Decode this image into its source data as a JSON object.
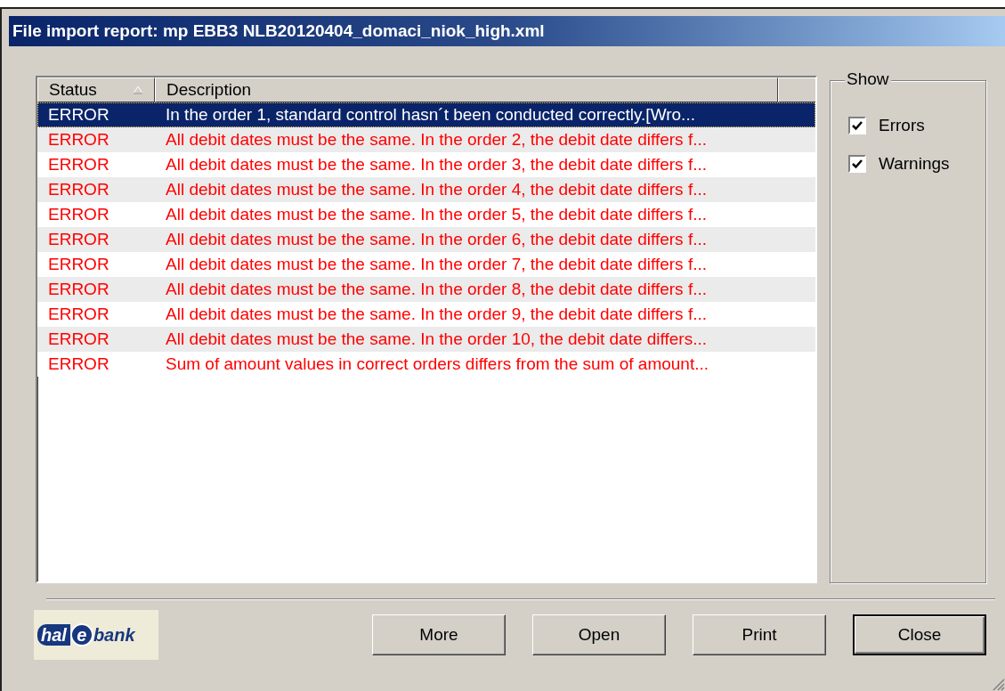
{
  "window": {
    "title": "File import report: mp EBB3 NLB20120404_domaci_niok_high.xml"
  },
  "table": {
    "columns": [
      {
        "label": "Status",
        "sorted": true
      },
      {
        "label": "Description",
        "sorted": false
      }
    ],
    "rows": [
      {
        "status": "ERROR",
        "description": "In the order 1, standard control hasn´t been conducted correctly.[Wro...",
        "selected": true
      },
      {
        "status": "ERROR",
        "description": "All debit dates must be the same. In the order 2, the debit date differs f...",
        "selected": false
      },
      {
        "status": "ERROR",
        "description": "All debit dates must be the same. In the order 3, the debit date differs f...",
        "selected": false
      },
      {
        "status": "ERROR",
        "description": "All debit dates must be the same. In the order 4, the debit date differs f...",
        "selected": false
      },
      {
        "status": "ERROR",
        "description": "All debit dates must be the same. In the order 5, the debit date differs f...",
        "selected": false
      },
      {
        "status": "ERROR",
        "description": "All debit dates must be the same. In the order 6, the debit date differs f...",
        "selected": false
      },
      {
        "status": "ERROR",
        "description": "All debit dates must be the same. In the order 7, the debit date differs f...",
        "selected": false
      },
      {
        "status": "ERROR",
        "description": "All debit dates must be the same. In the order 8, the debit date differs f...",
        "selected": false
      },
      {
        "status": "ERROR",
        "description": "All debit dates must be the same. In the order 9, the debit date differs f...",
        "selected": false
      },
      {
        "status": "ERROR",
        "description": "All debit dates must be the same. In the order 10, the debit date differs...",
        "selected": false
      },
      {
        "status": "ERROR",
        "description": "Sum of amount values in correct orders differs from the sum of amount...",
        "selected": false
      }
    ]
  },
  "show_group": {
    "title": "Show",
    "options": [
      {
        "label": "Errors",
        "checked": true
      },
      {
        "label": "Warnings",
        "checked": true
      }
    ]
  },
  "logo": {
    "parts": [
      "hal",
      "e",
      "bank"
    ]
  },
  "buttons": [
    {
      "label": "More",
      "default": false
    },
    {
      "label": "Open",
      "default": false
    },
    {
      "label": "Print",
      "default": false
    },
    {
      "label": "Close",
      "default": true
    }
  ]
}
